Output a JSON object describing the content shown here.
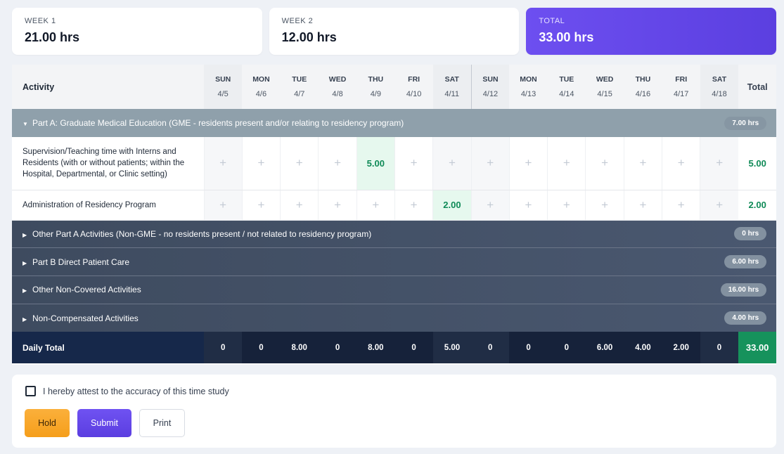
{
  "summary": {
    "week1": {
      "label": "WEEK 1",
      "value": "21.00 hrs"
    },
    "week2": {
      "label": "WEEK 2",
      "value": "12.00 hrs"
    },
    "total": {
      "label": "TOTAL",
      "value": "33.00 hrs"
    }
  },
  "table": {
    "activity_header": "Activity",
    "total_header": "Total",
    "days": [
      {
        "dow": "SUN",
        "date": "4/5"
      },
      {
        "dow": "MON",
        "date": "4/6"
      },
      {
        "dow": "TUE",
        "date": "4/7"
      },
      {
        "dow": "WED",
        "date": "4/8"
      },
      {
        "dow": "THU",
        "date": "4/9"
      },
      {
        "dow": "FRI",
        "date": "4/10"
      },
      {
        "dow": "SAT",
        "date": "4/11"
      },
      {
        "dow": "SUN",
        "date": "4/12"
      },
      {
        "dow": "MON",
        "date": "4/13"
      },
      {
        "dow": "TUE",
        "date": "4/14"
      },
      {
        "dow": "WED",
        "date": "4/15"
      },
      {
        "dow": "THU",
        "date": "4/16"
      },
      {
        "dow": "FRI",
        "date": "4/17"
      },
      {
        "dow": "SAT",
        "date": "4/18"
      }
    ],
    "sections": [
      {
        "label": "Part A: Graduate Medical Education (GME - residents present and/or relating to residency program)",
        "hours": "7.00 hrs",
        "expanded": true,
        "activities": [
          {
            "name": "Supervision/Teaching time with Interns and Residents (with or without patients; within the Hospital, Departmental, or Clinic setting)",
            "cells": [
              "",
              "",
              "",
              "",
              "5.00",
              "",
              "",
              "",
              "",
              "",
              "",
              "",
              "",
              ""
            ],
            "total": "5.00"
          },
          {
            "name": "Administration of Residency Program",
            "cells": [
              "",
              "",
              "",
              "",
              "",
              "",
              "2.00",
              "",
              "",
              "",
              "",
              "",
              "",
              ""
            ],
            "total": "2.00"
          }
        ]
      },
      {
        "label": "Other Part A Activities (Non-GME - no residents present / not related to residency program)",
        "hours": "0 hrs",
        "expanded": false
      },
      {
        "label": "Part B Direct Patient Care",
        "hours": "6.00 hrs",
        "expanded": false
      },
      {
        "label": "Other Non-Covered Activities",
        "hours": "16.00 hrs",
        "expanded": false
      },
      {
        "label": "Non-Compensated Activities",
        "hours": "4.00 hrs",
        "expanded": false
      }
    ],
    "empty_cell_symbol": "+",
    "daily_total": {
      "label": "Daily Total",
      "values": [
        "0",
        "0",
        "8.00",
        "0",
        "8.00",
        "0",
        "5.00",
        "0",
        "0",
        "0",
        "6.00",
        "4.00",
        "2.00",
        "0"
      ],
      "grand_total": "33.00"
    }
  },
  "attest": {
    "checkbox_label": "I hereby attest to the accuracy of this time study",
    "checked": false
  },
  "actions": {
    "hold": "Hold",
    "submit": "Submit",
    "print": "Print"
  },
  "colors": {
    "accent": "#5b3fe0",
    "hold": "#f59e1b",
    "positive": "#0f8a57",
    "section_dark": "#3e4b5f",
    "section_open": "#8fa0ab",
    "daily_total_bg": "#16223a"
  },
  "icons": {
    "expanded_caret": "caret-down-icon",
    "collapsed_caret": "caret-right-icon",
    "add_cell": "plus-icon"
  }
}
